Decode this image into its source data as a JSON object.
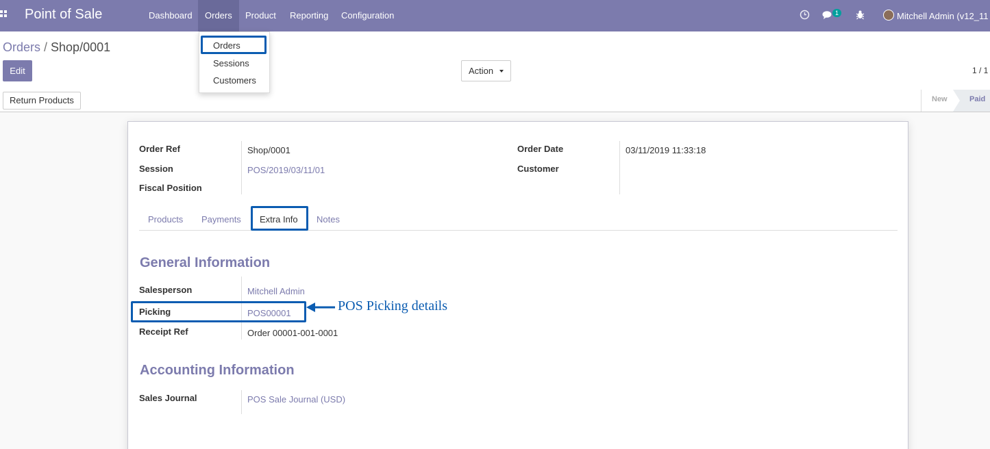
{
  "navbar": {
    "app_title": "Point of Sale",
    "menu": [
      "Dashboard",
      "Orders",
      "Product",
      "Reporting",
      "Configuration"
    ],
    "messages_badge": "1",
    "user_name": "Mitchell Admin (v12_11"
  },
  "orders_dropdown": {
    "items": [
      "Orders",
      "Sessions",
      "Customers"
    ]
  },
  "control_panel": {
    "breadcrumb_parent": "Orders",
    "breadcrumb_separator": "/",
    "breadcrumb_current": "Shop/0001",
    "edit_label": "Edit",
    "action_label": "Action",
    "pager": "1 / 1"
  },
  "statusbar": {
    "return_products_label": "Return Products",
    "stages": [
      "New",
      "Paid"
    ],
    "active_stage": "Paid"
  },
  "form": {
    "order_ref_label": "Order Ref",
    "order_ref_value": "Shop/0001",
    "session_label": "Session",
    "session_value": "POS/2019/03/11/01",
    "fiscal_position_label": "Fiscal Position",
    "order_date_label": "Order Date",
    "order_date_value": "03/11/2019 11:33:18",
    "customer_label": "Customer",
    "tabs": [
      "Products",
      "Payments",
      "Extra Info",
      "Notes"
    ],
    "active_tab": "Extra Info",
    "general_section_title": "General Information",
    "salesperson_label": "Salesperson",
    "salesperson_value": "Mitchell Admin",
    "picking_label": "Picking",
    "picking_value": "POS00001",
    "receipt_ref_label": "Receipt Ref",
    "receipt_ref_value": "Order 00001-001-0001",
    "accounting_section_title": "Accounting Information",
    "sales_journal_label": "Sales Journal",
    "sales_journal_value": "POS Sale Journal (USD)"
  },
  "annotation": {
    "text": "POS Picking details"
  },
  "colors": {
    "brand": "#7c7bad",
    "highlight": "#0b5cb1",
    "badge": "#00a09d"
  }
}
